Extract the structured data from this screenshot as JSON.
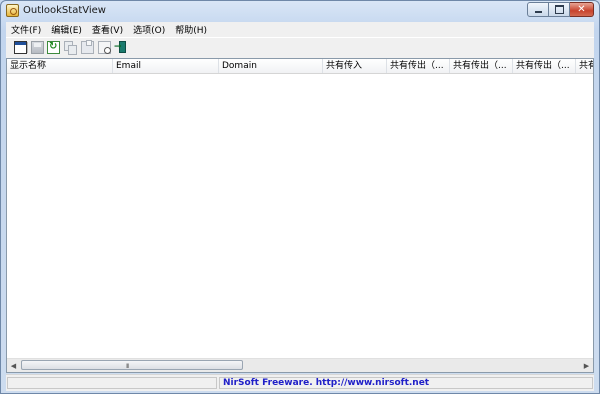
{
  "window": {
    "title": "OutlookStatView"
  },
  "menu": [
    "文件(F)",
    "编辑(E)",
    "查看(V)",
    "选项(O)",
    "帮助(H)"
  ],
  "toolbar": {
    "buttons": [
      {
        "icon": "html-report-icon",
        "enabled": true
      },
      {
        "icon": "save-icon",
        "enabled": false
      },
      {
        "icon": "refresh-icon",
        "enabled": true
      },
      {
        "icon": "copy-icon",
        "enabled": false
      },
      {
        "icon": "properties-icon",
        "enabled": false
      },
      {
        "icon": "find-icon",
        "enabled": false
      },
      {
        "icon": "exit-icon",
        "enabled": true
      }
    ]
  },
  "columns": [
    "显示名称",
    "Email",
    "Domain",
    "共有传入",
    "共有传出（...",
    "共有传出（...",
    "共有传出（...",
    "共有传"
  ],
  "status": {
    "left": "",
    "link_text": "NirSoft Freeware.  http://www.nirsoft.net"
  },
  "scrollbar": {
    "grip": "III"
  },
  "colors": {
    "link": "#2020c8",
    "close_button": "#c8432d"
  }
}
